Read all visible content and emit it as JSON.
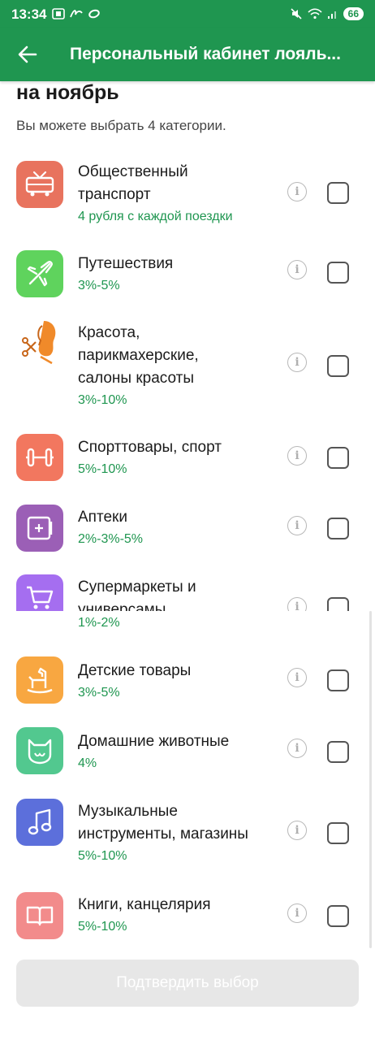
{
  "status": {
    "time": "13:34",
    "battery": "66"
  },
  "header": {
    "title": "Персональный кабинет лояль..."
  },
  "page": {
    "heading": "на ноябрь",
    "subheading": "Вы можете выбрать 4 категории."
  },
  "categories": [
    {
      "title_line1": "Общественный",
      "title_line2": "транспорт",
      "subtitle": "4 рубля с каждой поездки",
      "icon": "bus-icon",
      "color": "#e8735e"
    },
    {
      "title_line1": "Путешествия",
      "subtitle": "3%-5%",
      "icon": "airplane-icon",
      "color": "#5fd35d"
    },
    {
      "title_line1": "Красота,",
      "title_line2": "парикмахерские,",
      "title_line3": "салоны красоты",
      "subtitle": "3%-10%",
      "icon": "beauty-woman-icon",
      "color": "#f08a2a"
    },
    {
      "title_line1": "Спорттовары, спорт",
      "subtitle": "5%-10%",
      "icon": "dumbbell-icon",
      "color": "#f2775f"
    },
    {
      "title_line1": "Аптеки",
      "subtitle": "2%-3%-5%",
      "icon": "pharmacy-icon",
      "color": "#9b5fb6"
    },
    {
      "title_line1": "Супермаркеты и",
      "title_line2": "универсамы",
      "subtitle": "1%-2%",
      "icon": "cart-icon",
      "color": "#a56ef0"
    },
    {
      "title_line1": "Детские товары",
      "subtitle": "3%-5%",
      "icon": "rocking-horse-icon",
      "color": "#f8a741"
    },
    {
      "title_line1": "Домашние животные",
      "subtitle": "4%",
      "icon": "cat-icon",
      "color": "#52c88f"
    },
    {
      "title_line1": "Музыкальные",
      "title_line2": "инструменты, магазины",
      "subtitle": "5%-10%",
      "icon": "music-note-icon",
      "color": "#5c6fdb"
    },
    {
      "title_line1": "Книги, канцелярия",
      "subtitle": "5%-10%",
      "icon": "book-icon",
      "color": "#f28b8b"
    }
  ],
  "info_symbol": "i",
  "confirm_button": "Подтвердить выбор"
}
